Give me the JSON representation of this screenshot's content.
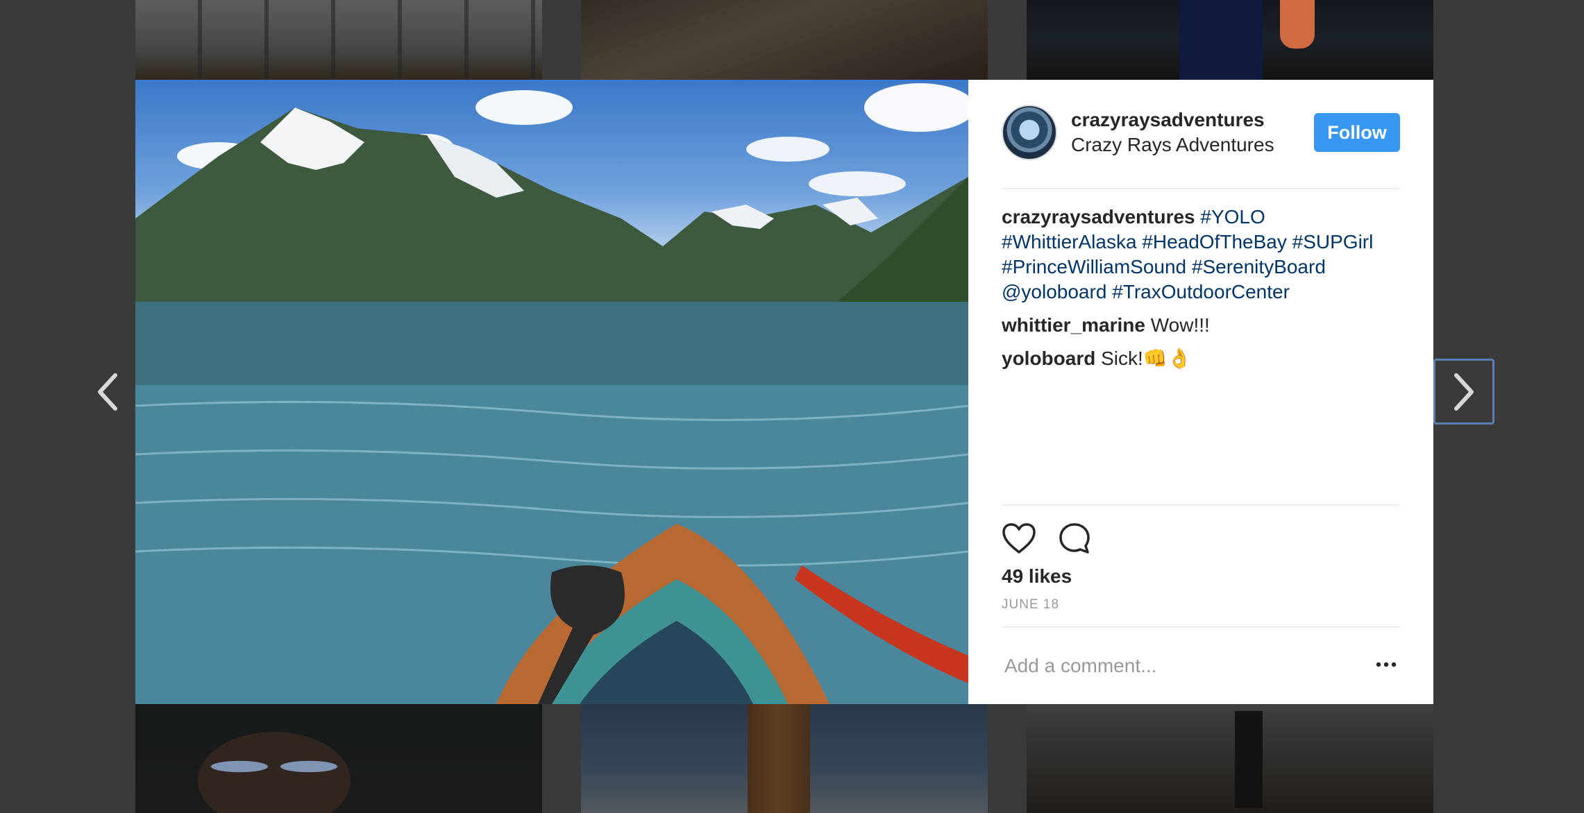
{
  "post": {
    "username": "crazyraysadventures",
    "full_name": "Crazy Rays Adventures",
    "follow_label": "Follow",
    "photo_alt": "Paddleboard on glacial lake with mountains",
    "likes": "49 likes",
    "date": "JUNE 18"
  },
  "comments": [
    {
      "user": "crazyraysadventures",
      "text_parts": [
        "#YOLO",
        "#WhittierAlaska",
        "#HeadOfTheBay",
        "#SUPGirl",
        "#PrinceWilliamSound",
        "#SerenityBoard",
        "@yoloboard",
        "#TraxOutdoorCenter"
      ]
    },
    {
      "user": "whittier_marine",
      "text": "Wow!!!"
    },
    {
      "user": "yoloboard",
      "text": "Sick!👊👌"
    }
  ],
  "composer": {
    "placeholder": "Add a comment..."
  },
  "icons": {
    "like": "heart-icon",
    "comment": "comment-icon",
    "more": "more-options-icon",
    "prev": "chevron-left-icon",
    "next": "chevron-right-icon"
  },
  "colors": {
    "accent": "#3897f0",
    "tag": "#003569",
    "muted": "#999999"
  }
}
